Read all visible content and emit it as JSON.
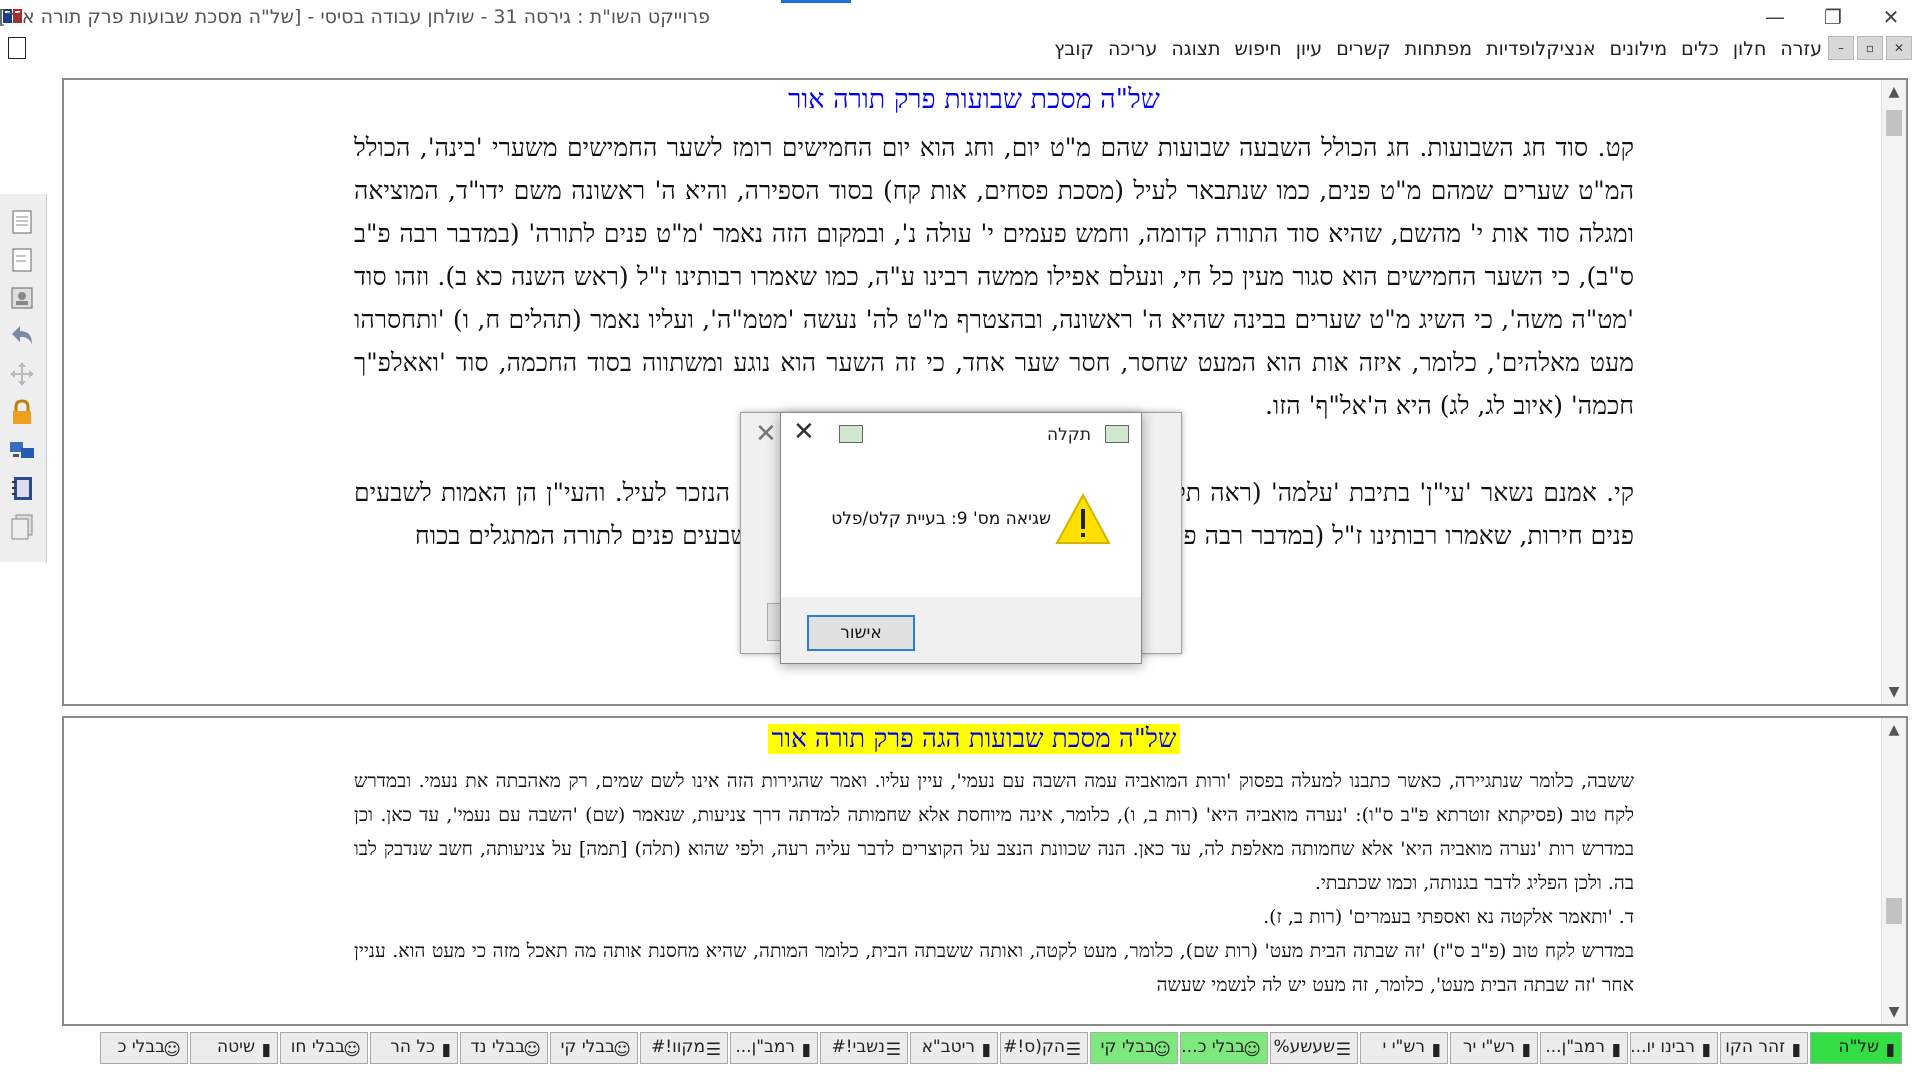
{
  "window": {
    "title": "פרוייקט השו\"ת  :  גירסה 31  -  שולחן עבודה בסיסי - [של\"ה מסכת שבועות פרק תורה אור]",
    "minimize": "—",
    "restore": "❐",
    "close": "✕"
  },
  "menu": {
    "items": [
      "קובץ",
      "עריכה",
      "תצוגה",
      "חיפוש",
      "עיון",
      "קשרים",
      "מפתחות",
      "אנציקלופדיות",
      "מילונים",
      "כלים",
      "חלון",
      "עזרה"
    ],
    "mdi": [
      "–",
      "▫",
      "✕"
    ]
  },
  "top_pane": {
    "heading": "של\"ה מסכת שבועות פרק תורה אור",
    "paragraphs": [
      "קט. סוד חג השבועות. חג הכולל השבעה שבועות שהם מ\"ט יום, וחג הוא יום החמישים רומז לשער החמישים משערי 'בינה', הכולל המ\"ט שערים שמהם מ\"ט פנים, כמו שנתבאר לעיל (מסכת פסחים, אות קח) בסוד הספירה, והיא ה' ראשונה משם ידו\"ד, המוציאה ומגלה סוד אות י' מהשם, שהיא סוד התורה קדומה, וחמש פעמים י' עולה נ', ובמקום הזה נאמר 'מ\"ט פנים לתורה' (במדבר רבה פ\"ב ס\"ב), כי השער החמישים הוא סגור מעין כל חי, ונעלם אפילו ממשה רבינו ע\"ה, כמו שאמרו רבותינו ז\"ל (ראש השנה כא ב). וזהו סוד 'מט\"ה משה', כי השיג מ\"ט שערים בבינה שהיא ה' ראשונה, ובהצטרף מ\"ט לה' נעשה 'מטמ\"ה', ועליו נאמר (תהלים ח, ו) 'ותחסרהו מעט מאלהים', כלומר, איזה אות הוא המעט שחסר, חסר שער אחד, כי זה השער הוא נוגע ומשתווה בסוד החכמה, סוד 'ואאלפ\"ך חכמה' (איוב לג, לג) היא ה'אל\"ף' הזו.",
      "קי. אמנם נשאר 'עי\"ן' בתיבת 'עלמה' (ראה תקוני זהר, בהקדמה דף ז' ע\"ב), והם מ\"ט פנים הנזכר לעיל. והעי\"ן הן האמות לשבעים פנים חירות, שאמרו רבותינו ז\"ל (במדבר רבה פי\"ג ס\"ט) - מ\"ט פנים טהור, מ\"ט פנים טמא, שבעים פנים לתורה המתגלים בכוח"
    ]
  },
  "bottom_pane": {
    "heading": "של\"ה מסכת שבועות הגה פרק תורה אור",
    "paragraphs": [
      "ששבה, כלומר שנתגיירה, כאשר כתבנו למעלה בפסוק 'ורות המואביה עמה השבה עם נעמי', עיין עליו. ואמר שהגירות הזה אינו לשם שמים, רק מאהבתה את נעמי. ובמדרש לקח טוב (פסיקתא זוטרתא פ\"ב ס\"ו): 'נערה מואביה היא' (רות ב, ו), כלומר, אינה מיוחסת אלא שחמותה למדתה דרך צניעות, שנאמר (שם) 'השבה עם נעמי', עד כאן. וכן במדרש רות 'נערה מואביה היא' אלא שחמותה מאלפת לה, עד כאן. הנה שכוונת הנצב על הקוצרים לדבר עליה רעה, ולפי שהוא (תלה) [תמה] על צניעותה, חשב שנדבק לבו בה. ולכן הפליג לדבר בגנותה, וכמו שכתבתי.",
      "ד. 'ותאמר אלקטה נא ואספתי בעמרים' (רות ב, ז).",
      "במדרש לקח טוב (פ\"ב ס\"ז) 'זה שבתה הבית מעט' (רות שם), כלומר, מעט לקטה, ואותה ששבתה הבית, כלומר המותה, שהיא מחסנת אותה מה תאכל מזה כי מעט הוא. עניין אחר 'זה שבתה הבית מעט', כלומר, זה מעט יש לה לנשמי שעשה"
    ]
  },
  "toolbar_icons": [
    "document-icon",
    "page-icon",
    "card-icon",
    "undo-arrow-icon",
    "move-icon",
    "lock-icon",
    "network-icon",
    "notebook-icon",
    "pages-icon"
  ],
  "tabs": [
    {
      "label": "של\"ה"
    },
    {
      "label": "זהר הקו"
    },
    {
      "label": "רבינו יו..."
    },
    {
      "label": "רמב\"ן..."
    },
    {
      "label": "רש\"י יר"
    },
    {
      "label": "רש\"י י"
    },
    {
      "label": "שעשע%"
    },
    {
      "label": "בבלי כ..."
    },
    {
      "label": "בבלי קי"
    },
    {
      "label": "הק(ס!#"
    },
    {
      "label": "ריטב\"א"
    },
    {
      "label": "נשבי!#"
    },
    {
      "label": "רמב\"ן..."
    },
    {
      "label": "מקוו!#"
    },
    {
      "label": "בבלי קי"
    },
    {
      "label": "בבלי נד"
    },
    {
      "label": "כל הר"
    },
    {
      "label": "בבלי חו"
    },
    {
      "label": "שיטה"
    },
    {
      "label": "בבלי כ"
    }
  ],
  "dialog": {
    "title": "תקלה",
    "message": "שגיאה מס' 9: בעיית קלט/פלט",
    "ok_label": "אישור",
    "close": "✕"
  },
  "dialog_back": {
    "close": "✕"
  }
}
